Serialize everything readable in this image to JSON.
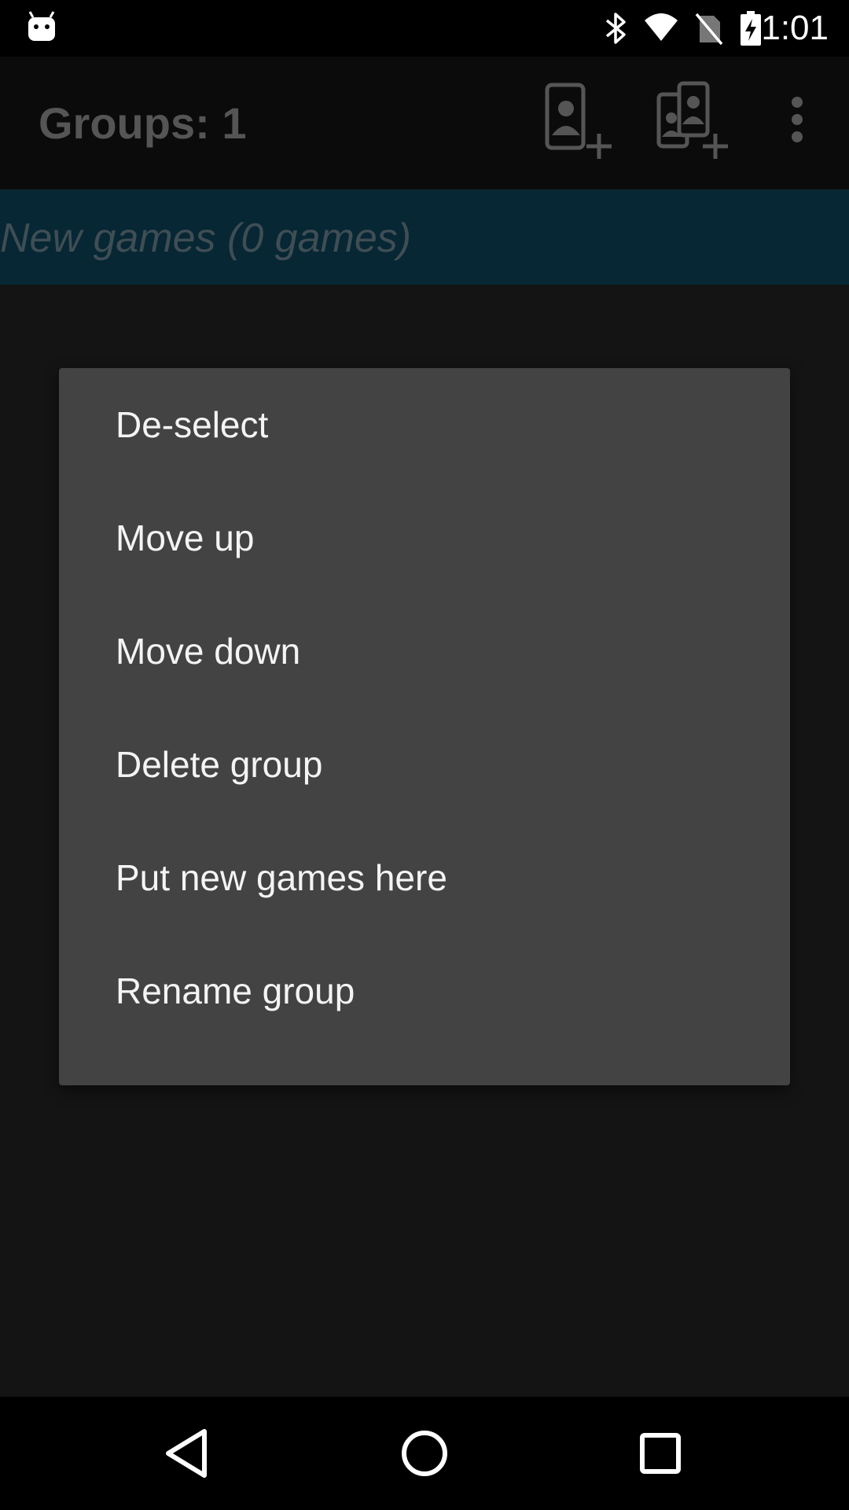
{
  "status_bar": {
    "time": "1:01",
    "icons": [
      "android-debug-icon",
      "bluetooth-icon",
      "wifi-icon",
      "no-sim-icon",
      "battery-charging-icon"
    ]
  },
  "app_bar": {
    "title": "Groups: 1",
    "actions": [
      "add-player-icon",
      "add-players-icon",
      "overflow-menu-icon"
    ]
  },
  "group_list": {
    "items": [
      {
        "label": "New games (0 games)"
      }
    ]
  },
  "context_menu": {
    "items": [
      {
        "label": "De-select"
      },
      {
        "label": "Move up"
      },
      {
        "label": "Move down"
      },
      {
        "label": "Delete group"
      },
      {
        "label": "Put new games here"
      },
      {
        "label": "Rename group"
      }
    ]
  },
  "nav_bar": {
    "buttons": [
      "back-icon",
      "home-icon",
      "recent-apps-icon"
    ]
  },
  "colors": {
    "dialog_background": "#434343",
    "group_row_background": "#062733",
    "screen_background": "#141414"
  }
}
